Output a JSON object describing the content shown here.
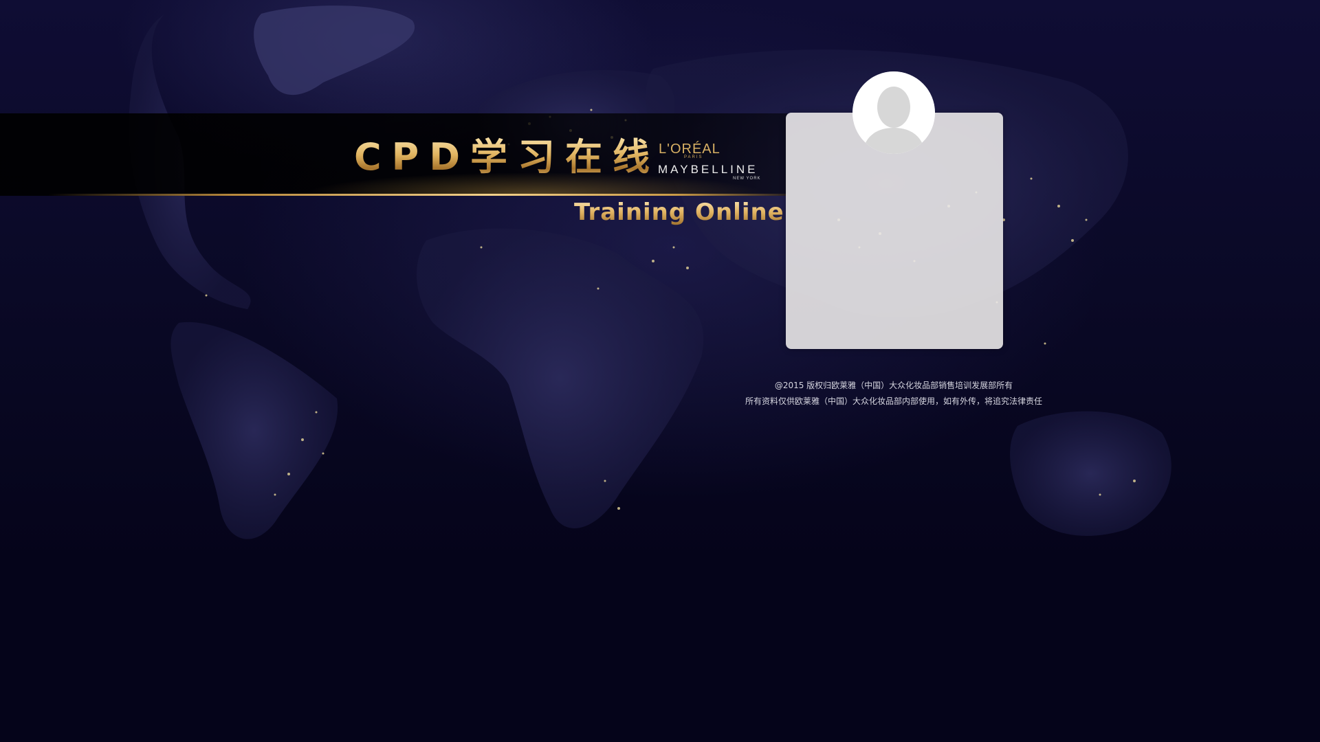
{
  "branding": {
    "title": "CPD学习在线",
    "loreal": "L'ORÉAL",
    "paris": "PARIS",
    "maybelline": "MAYBELLINE",
    "newyork": "NEW YORK",
    "subtitle": "Training Online"
  },
  "login_card": {
    "avatar_icon": "user-silhouette-icon"
  },
  "footer": {
    "copyright": "@2015 版权归欧莱雅（中国）大众化妆品部销售培训发展部所有",
    "notice": "所有资料仅供欧莱雅（中国）大众化妆品部内部使用，如有外传，将追究法律责任"
  },
  "colors": {
    "background": "#05041a",
    "gold": "#d9a94f",
    "card": "#eae8e8"
  }
}
